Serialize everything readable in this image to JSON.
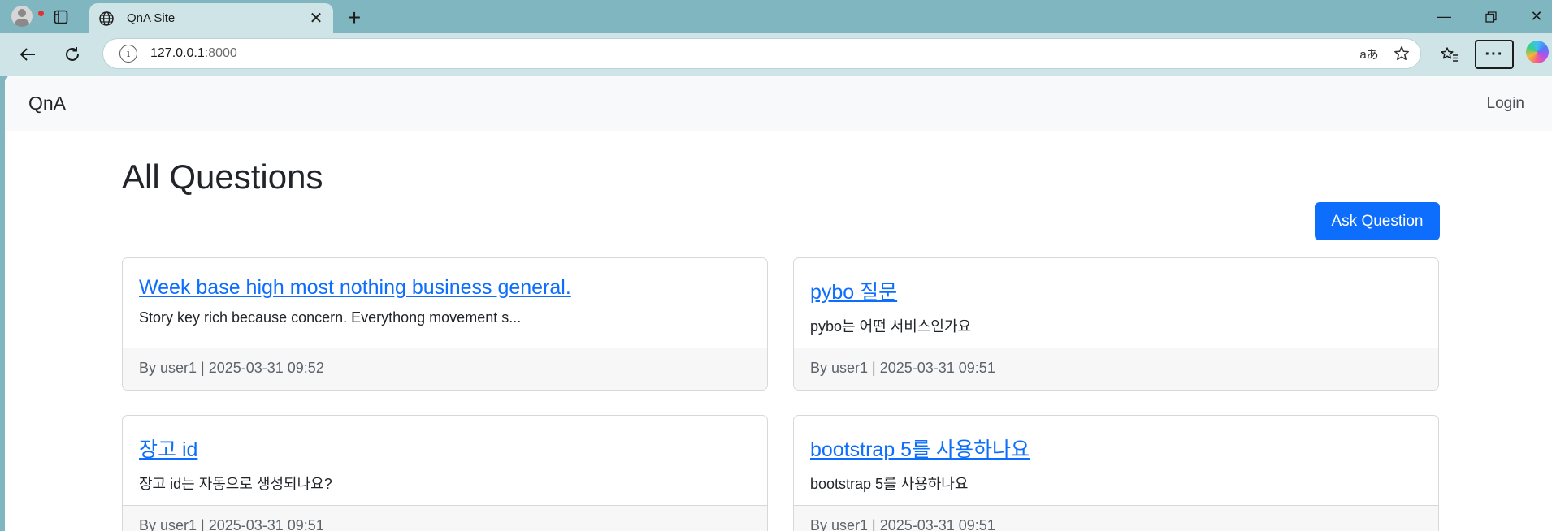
{
  "browser": {
    "tab_title": "QnA Site",
    "url_host": "127.0.0.1",
    "url_port": ":8000"
  },
  "navbar": {
    "brand": "QnA",
    "login": "Login"
  },
  "main": {
    "title": "All Questions",
    "ask_button": "Ask Question"
  },
  "questions": [
    {
      "title": "Week base high most nothing business general.",
      "snippet": "Story key rich because concern. Everythong movement s...",
      "meta": "By user1 | 2025-03-31 09:52"
    },
    {
      "title": "pybo 질문",
      "snippet": "pybo는 어떤 서비스인가요",
      "meta": "By user1 | 2025-03-31 09:51"
    },
    {
      "title": "장고 id",
      "snippet": "장고 id는 자동으로 생성되나요?",
      "meta": "By user1 | 2025-03-31 09:51"
    },
    {
      "title": "bootstrap 5를 사용하나요",
      "snippet": "bootstrap 5를 사용하나요",
      "meta": "By user1 | 2025-03-31 09:51"
    }
  ],
  "colors": {
    "primary": "#0d6efd",
    "chrome": "#7fb6c0",
    "chrome_light": "#cfe4e7"
  }
}
